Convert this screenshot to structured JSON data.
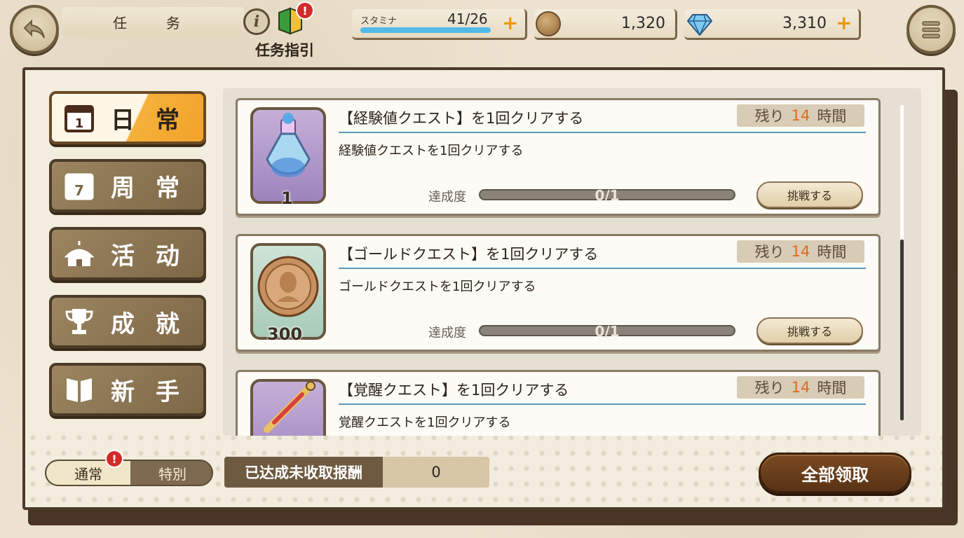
{
  "header": {
    "title": "任　务",
    "guide_label": "任务指引",
    "guide_alert": "!",
    "info_glyph": "i"
  },
  "resources": {
    "stamina_label": "スタミナ",
    "stamina_value": "41/26",
    "stamina_fill": 1.0,
    "plus": "+",
    "gold": "1,320",
    "gems": "3,310"
  },
  "sidebar": {
    "items": [
      {
        "label": "日常",
        "icon": "calendar-day-icon",
        "active": true
      },
      {
        "label": "周常",
        "icon": "calendar-week-icon",
        "active": false
      },
      {
        "label": "活动",
        "icon": "tent-icon",
        "active": false
      },
      {
        "label": "成就",
        "icon": "trophy-icon",
        "active": false
      },
      {
        "label": "新手",
        "icon": "book-icon",
        "active": false
      }
    ]
  },
  "quests": [
    {
      "title": "【経験値クエスト】を1回クリアする",
      "time_prefix": "残り",
      "time_num": "14",
      "time_suffix": "時間",
      "desc": "経験値クエストを1回クリアする",
      "progress_label": "達成度",
      "progress": "0/1",
      "button": "挑戦する",
      "reward_count": "1",
      "reward_icon": "potion-icon"
    },
    {
      "title": "【ゴールドクエスト】を1回クリアする",
      "time_prefix": "残り",
      "time_num": "14",
      "time_suffix": "時間",
      "desc": "ゴールドクエストを1回クリアする",
      "progress_label": "達成度",
      "progress": "0/1",
      "button": "挑戦する",
      "reward_count": "300",
      "reward_icon": "gold-coin-icon"
    },
    {
      "title": "【覚醒クエスト】を1回クリアする",
      "time_prefix": "残り",
      "time_num": "14",
      "time_suffix": "時間",
      "desc": "覚醒クエストを1回クリアする",
      "reward_icon": "sword-vial-icon"
    }
  ],
  "footer": {
    "toggle_normal": "通常",
    "toggle_special": "特別",
    "toggle_alert": "!",
    "unclaimed_label": "已达成未收取报酬",
    "unclaimed_count": "0",
    "claim_all": "全部领取"
  },
  "colors": {
    "accent": "#f2a22a",
    "brown": "#5a3214",
    "time_highlight": "#e06a1a",
    "stamina": "#52b9e8"
  }
}
